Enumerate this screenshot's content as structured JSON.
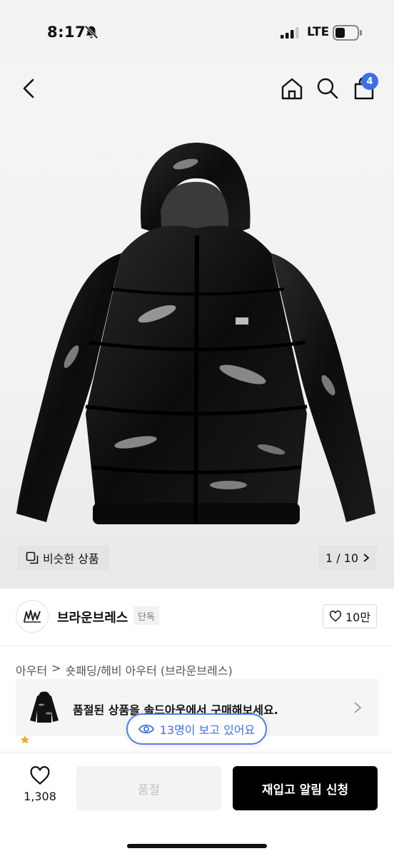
{
  "status_bar": {
    "time": "8:17",
    "network": "LTE"
  },
  "header": {
    "cart_count": "4"
  },
  "gallery": {
    "similar_label": "비슷한 상품",
    "counter": "1 / 10"
  },
  "brand": {
    "name": "브라운브레스",
    "badge": "단독",
    "likes": "10만"
  },
  "breadcrumb": {
    "category": "아우터",
    "separator": ">",
    "subcategory": "숏패딩/헤비 아우터 (브라운브레스)"
  },
  "notice": {
    "text": "품절된 상품을 솔드아웃에서 구매해보세요.",
    "viewers": "13명이 보고 있어요"
  },
  "bottom_bar": {
    "wish_count": "1,308",
    "soldout_label": "품절",
    "restock_label": "재입고 알림 신청"
  },
  "colors": {
    "accent": "#3d6fe8",
    "primary_button": "#000000",
    "disabled_button": "#f3f3f3"
  },
  "icons": [
    "bell-slash-icon",
    "signal-icon",
    "battery-icon",
    "back-chevron-icon",
    "home-icon",
    "search-icon",
    "cart-icon",
    "gallery-icon",
    "chevron-right-icon",
    "heart-icon",
    "eye-icon"
  ]
}
